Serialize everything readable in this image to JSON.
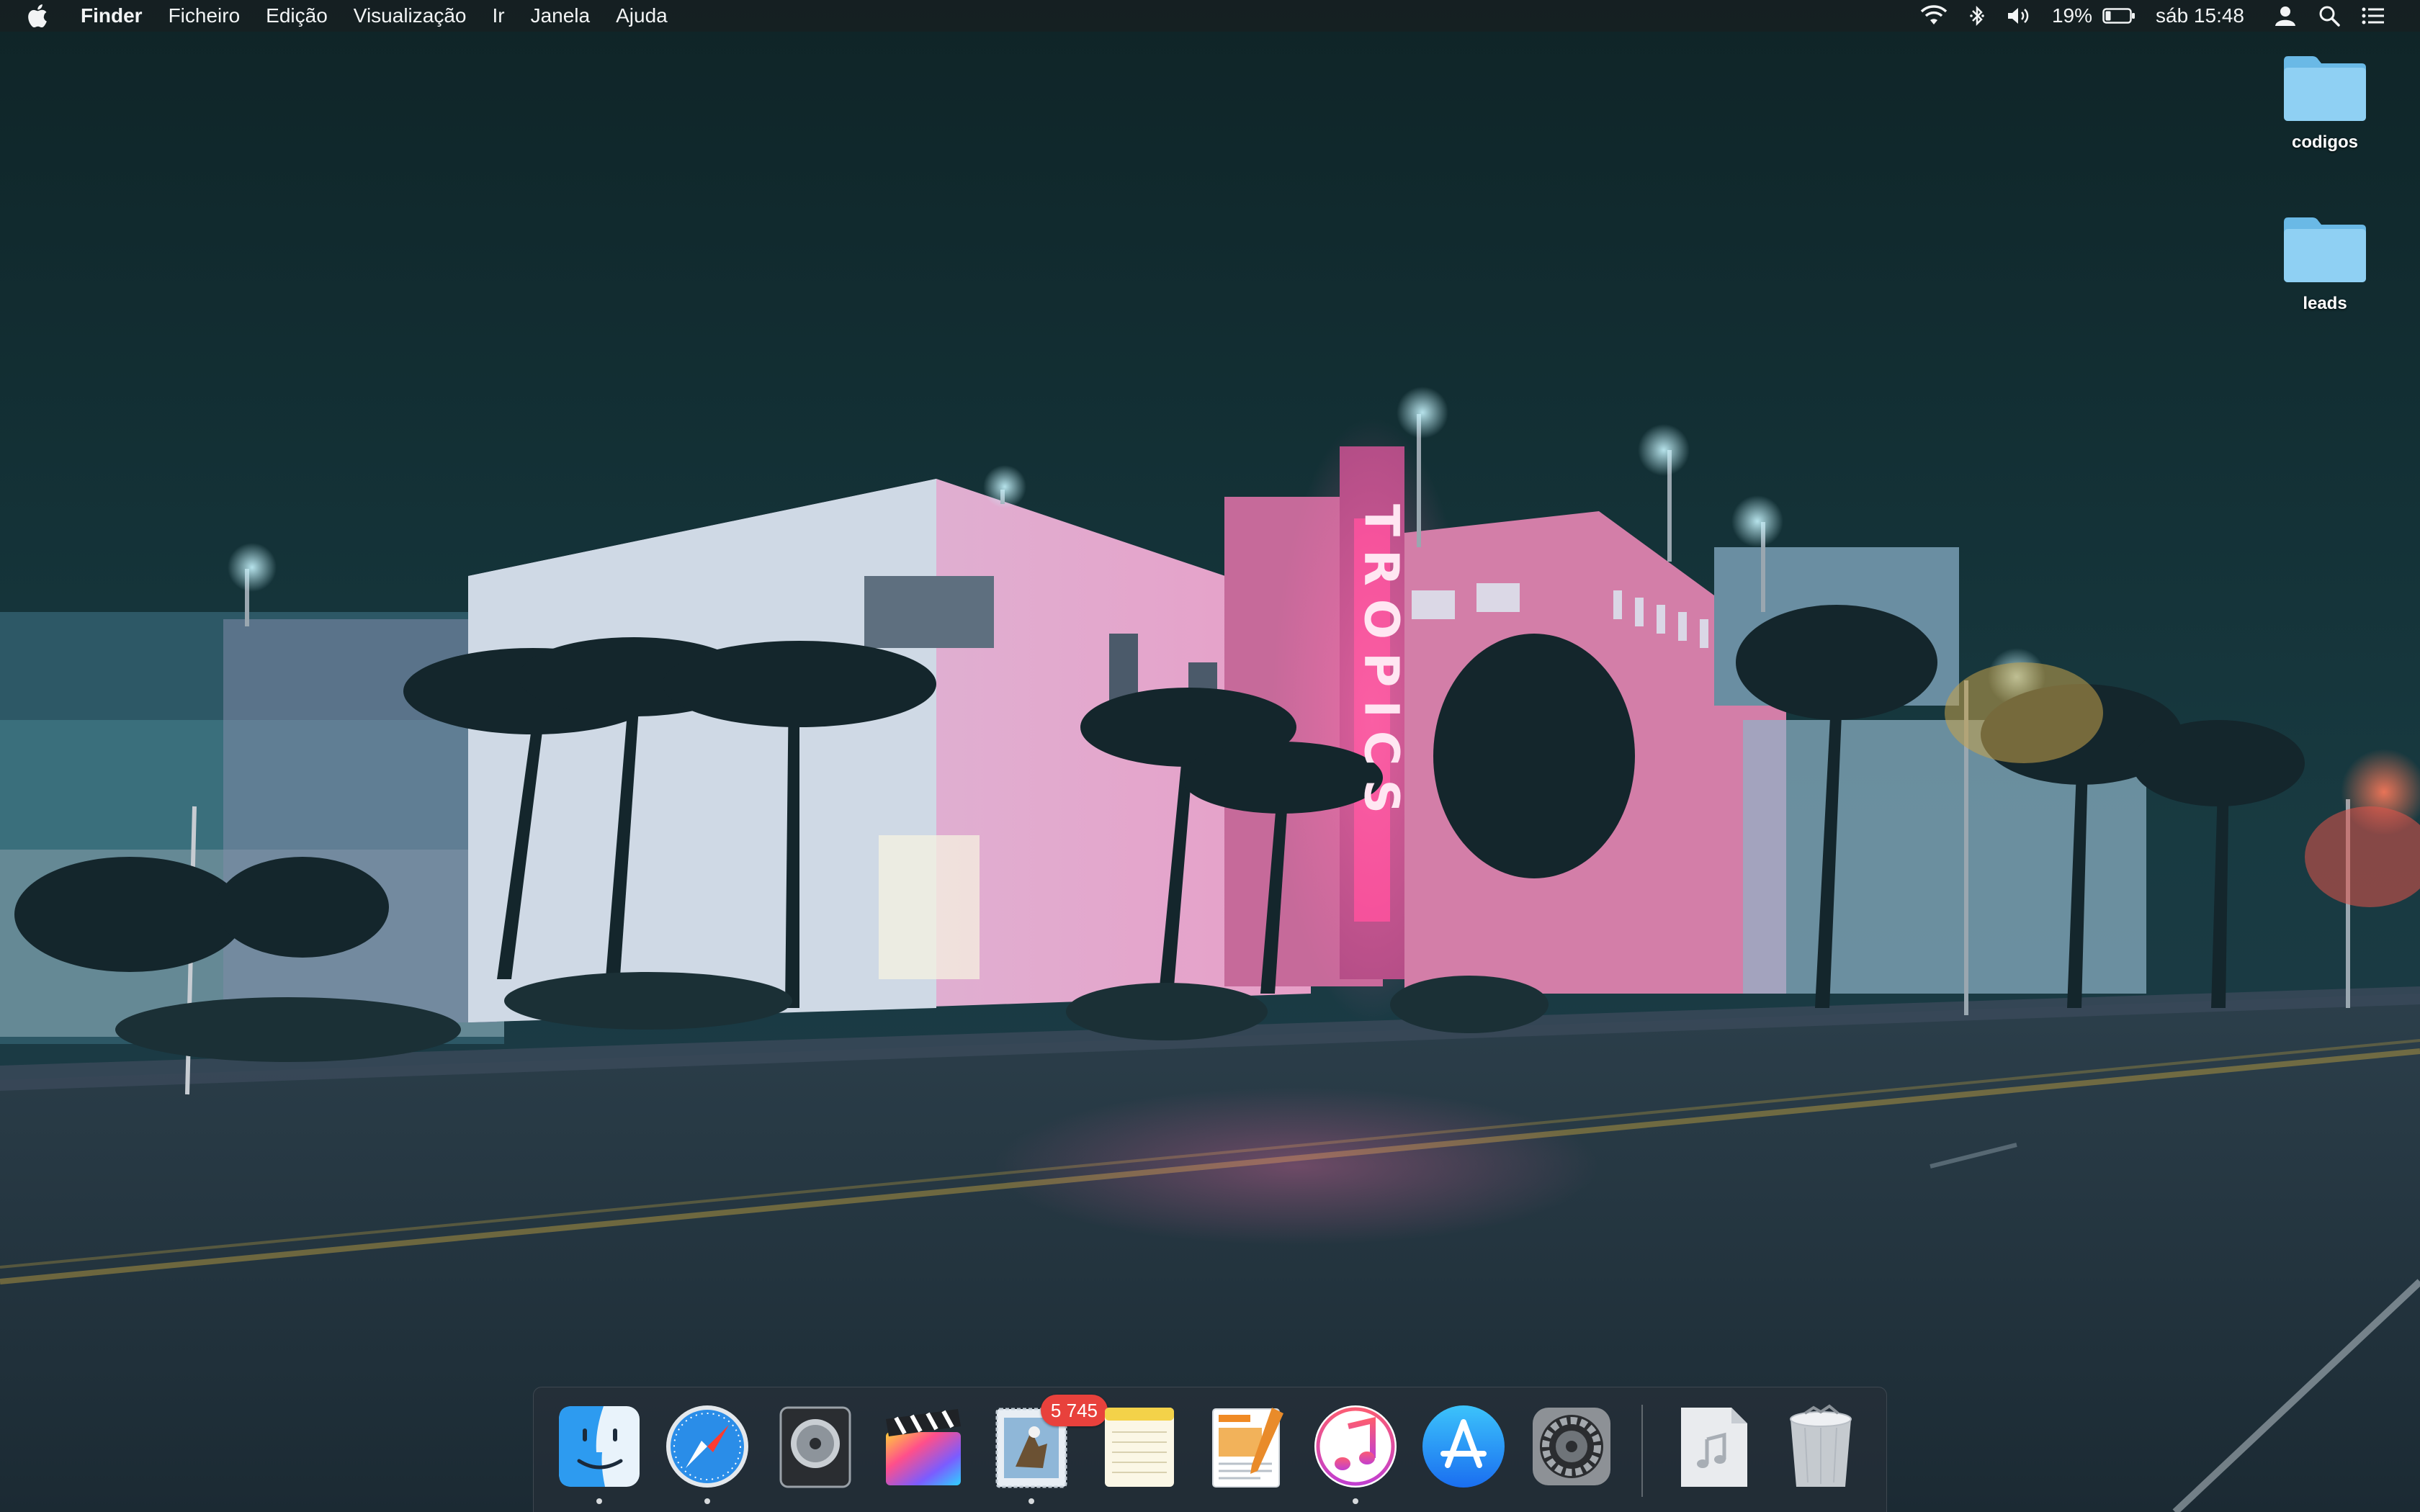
{
  "menubar": {
    "apple_icon": "apple-logo-icon",
    "app_name": "Finder",
    "menus": [
      "Ficheiro",
      "Edição",
      "Visualização",
      "Ir",
      "Janela",
      "Ajuda"
    ],
    "status": {
      "wifi_icon": "wifi-icon",
      "bluetooth_icon": "bluetooth-icon",
      "volume_icon": "volume-icon",
      "battery_percent": "19%",
      "battery_icon": "battery-icon",
      "clock": "sáb 15:48",
      "user_icon": "user-icon",
      "spotlight_icon": "spotlight-search-icon",
      "notification_icon": "notification-center-icon"
    }
  },
  "wallpaper": {
    "sign_text": "TROPICS"
  },
  "desktop_icons": [
    {
      "label": "codigos",
      "icon": "folder-icon"
    },
    {
      "label": "leads",
      "icon": "folder-icon"
    }
  ],
  "dock": {
    "apps": [
      {
        "name": "Finder",
        "icon": "finder-icon",
        "running": true
      },
      {
        "name": "Safari",
        "icon": "safari-icon",
        "running": true
      },
      {
        "name": "Logic Pro",
        "icon": "logic-pro-icon",
        "running": false
      },
      {
        "name": "Final Cut Pro",
        "icon": "final-cut-pro-icon",
        "running": false
      },
      {
        "name": "Mail",
        "icon": "mail-icon",
        "running": true,
        "badge": "5 745"
      },
      {
        "name": "Notes",
        "icon": "notes-icon",
        "running": false
      },
      {
        "name": "Pages",
        "icon": "pages-icon",
        "running": false
      },
      {
        "name": "iTunes",
        "icon": "itunes-icon",
        "running": true
      },
      {
        "name": "App Store",
        "icon": "app-store-icon",
        "running": false
      },
      {
        "name": "System Preferences",
        "icon": "system-preferences-icon",
        "running": false
      }
    ],
    "others": [
      {
        "name": "Music document",
        "icon": "music-document-icon"
      },
      {
        "name": "Trash",
        "icon": "trash-icon"
      }
    ]
  },
  "colors": {
    "menubar_bg": "#162022",
    "sky_top": "#0f2427",
    "neon_pink": "#ff3c8a",
    "street_light": "#bfefff",
    "badge_red": "#e8413c",
    "folder_blue": "#7cc8ef"
  }
}
